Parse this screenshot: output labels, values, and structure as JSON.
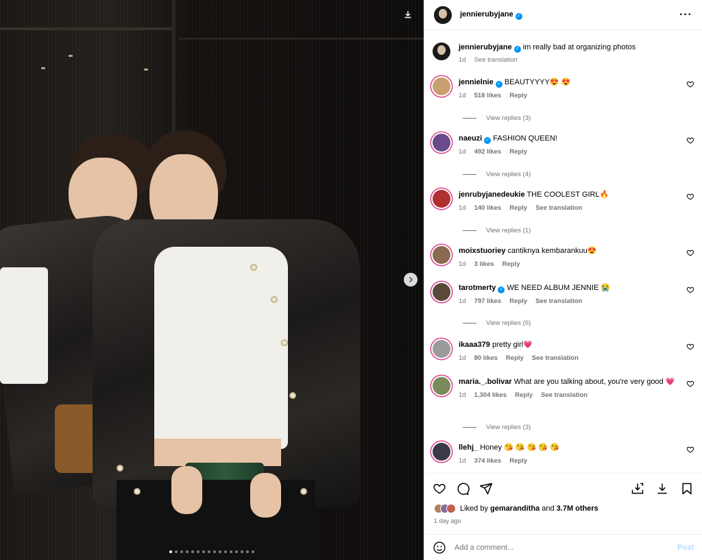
{
  "media": {
    "slide_count": 16,
    "active_slide": 1
  },
  "header": {
    "username": "jennierubyjane",
    "verified": true
  },
  "caption": {
    "username": "jennierubyjane",
    "text": "im really bad at organizing photos",
    "time": "1d",
    "see_translation": "See translation"
  },
  "comments": [
    {
      "username": "jennielnie",
      "verified": true,
      "text": "BEAUTYYYY😍 😍",
      "time": "1d",
      "likes": "518 likes",
      "reply": "Reply",
      "view_replies": "View replies (3)",
      "avatar_color": "#c8a070"
    },
    {
      "username": "naeuzi",
      "verified": true,
      "text": "FASHION QUEEN!",
      "time": "1d",
      "likes": "492 likes",
      "reply": "Reply",
      "view_replies": "View replies (4)",
      "avatar_color": "#6a4a8a"
    },
    {
      "username": "jenrubyjanedeukie",
      "verified": false,
      "text": "THE COOLEST GIRL🔥",
      "time": "1d",
      "likes": "140 likes",
      "reply": "Reply",
      "see_translation": "See translation",
      "view_replies": "View replies (1)",
      "avatar_color": "#b03030"
    },
    {
      "username": "moixstuoriey",
      "verified": false,
      "text": "cantiknya kembarankuu😍",
      "time": "1d",
      "likes": "3 likes",
      "reply": "Reply",
      "avatar_color": "#8a6a50"
    },
    {
      "username": "tarotmerty",
      "verified": true,
      "text": "WE NEED ALBUM JENNIE 😭",
      "time": "1d",
      "likes": "797 likes",
      "reply": "Reply",
      "see_translation": "See translation",
      "view_replies": "View replies (6)",
      "avatar_color": "#5a4a3a"
    },
    {
      "username": "ikaaa379",
      "verified": false,
      "text": "pretty girl💗",
      "time": "1d",
      "likes": "80 likes",
      "reply": "Reply",
      "see_translation": "See translation",
      "avatar_color": "#9a9a9a"
    },
    {
      "username": "maria._.bolivar",
      "verified": false,
      "text": "What are you talking about, you're very good 💗",
      "time": "1d",
      "likes": "1,304 likes",
      "reply": "Reply",
      "see_translation": "See translation",
      "view_replies": "View replies (3)",
      "avatar_color": "#7a8a5a"
    },
    {
      "username": "llehj_",
      "verified": false,
      "text": "Honey 😘 😘 😘 😘 😘",
      "time": "1d",
      "likes": "374 likes",
      "reply": "Reply",
      "avatar_color": "#3a3a4a"
    }
  ],
  "footer": {
    "liked_by_prefix": "Liked by",
    "liked_by_user": "gemaranditha",
    "liked_by_and": "and",
    "liked_by_others": "3.7M others",
    "time_ago": "1 day ago",
    "comment_placeholder": "Add a comment...",
    "post_label": "Post"
  },
  "colors": {
    "verified": "#0095f6",
    "story_ring": "#d93f8b",
    "post_disabled": "#b3dbff",
    "muted_text": "#737373"
  }
}
